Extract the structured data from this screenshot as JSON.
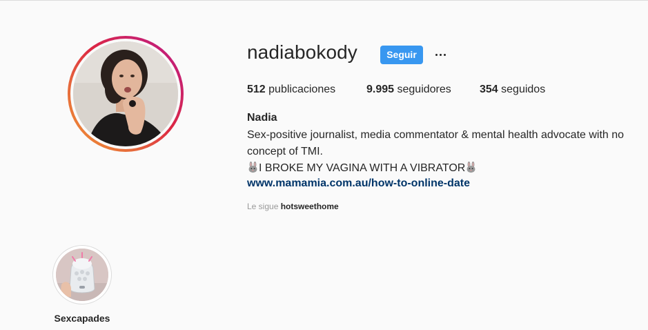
{
  "profile": {
    "username": "nadiabokody",
    "follow_label": "Seguir",
    "more_label": "...",
    "stats": {
      "posts_count": "512",
      "posts_label": "publicaciones",
      "followers_count": "9.995",
      "followers_label": "seguidores",
      "following_count": "354",
      "following_label": "seguidos"
    },
    "bio": {
      "name": "Nadia",
      "line1": "Sex-positive journalist, media commentator & mental health advocate with no",
      "line2": "concept of TMI.",
      "line3": "I BROKE MY VAGINA WITH A VIBRATOR",
      "line3_emoji": "rabbit-face-icon",
      "link": "www.mamamia.com.au/how-to-online-date"
    },
    "followed_by": {
      "prefix": "Le sigue",
      "user": "hotsweethome"
    }
  },
  "highlights": [
    {
      "label": "Sexcapades"
    }
  ],
  "colors": {
    "accent": "#3897f0",
    "link": "#003569",
    "text": "#262626",
    "muted": "#999999",
    "background": "#fafafa"
  }
}
